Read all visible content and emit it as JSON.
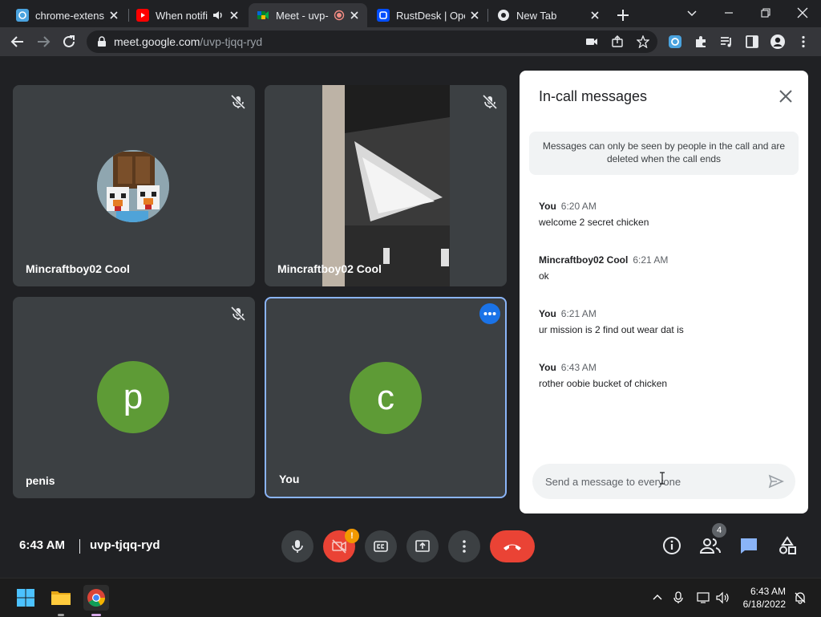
{
  "browser": {
    "tabs": [
      {
        "title": "chrome-extensio",
        "icon": "extension-favicon",
        "active": false
      },
      {
        "title": "When notifi",
        "icon": "youtube-favicon",
        "active": false
      },
      {
        "title": "Meet - uvp-",
        "icon": "google-meet-favicon",
        "active": true
      },
      {
        "title": "RustDesk | Oper",
        "icon": "rustdesk-favicon",
        "active": false
      },
      {
        "title": "New Tab",
        "icon": "chrome-favicon",
        "active": false
      }
    ],
    "url": {
      "host": "meet.google.com",
      "path": "/uvp-tjqq-ryd"
    }
  },
  "meet": {
    "participants": [
      {
        "name": "Mincraftboy02 Cool",
        "muted": true,
        "avatar": "minecraft-chicken-picture"
      },
      {
        "name": "Mincraftboy02 Cool",
        "muted": true,
        "video": "camera-feed"
      },
      {
        "name": "penis",
        "muted": true,
        "initial": "p"
      },
      {
        "name": "You",
        "muted": false,
        "initial": "c"
      }
    ],
    "time": "6:43 AM",
    "meeting_code": "uvp-tjqq-ryd",
    "alert_badge": "!",
    "people_count": "4",
    "colors": {
      "avatar": "#5e9b36",
      "accent": "#8ab4f8",
      "hangup": "#ea4335",
      "more_dot": "#1a73e8"
    }
  },
  "chat": {
    "title": "In-call messages",
    "notice": "Messages can only be seen by people in the call and are deleted when the call ends",
    "messages": [
      {
        "sender": "You",
        "time": "6:20 AM",
        "text": "welcome 2 secret chicken"
      },
      {
        "sender": "Mincraftboy02 Cool",
        "time": "6:21 AM",
        "text": "ok"
      },
      {
        "sender": "You",
        "time": "6:21 AM",
        "text": "ur mission is 2 find out wear dat is"
      },
      {
        "sender": "You",
        "time": "6:43 AM",
        "text": "rother oobie bucket of chicken"
      }
    ],
    "input_placeholder": "Send a message to everyone"
  },
  "taskbar": {
    "time": "6:43 AM",
    "date": "6/18/2022"
  }
}
